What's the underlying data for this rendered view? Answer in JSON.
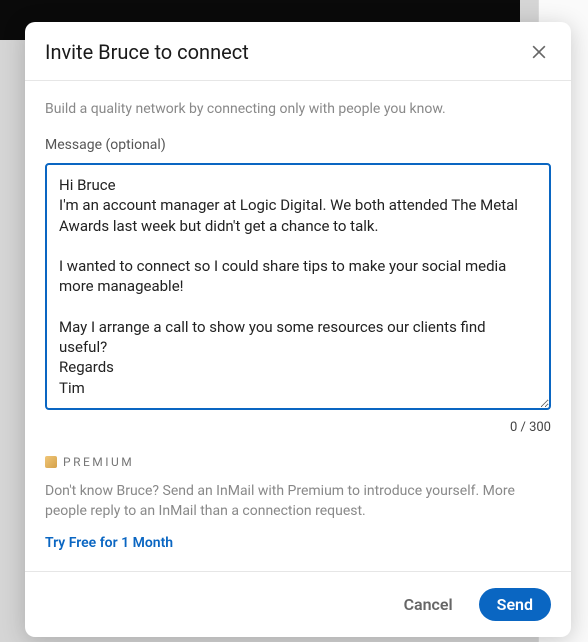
{
  "modal": {
    "title": "Invite Bruce to connect",
    "intro": "Build a quality network by connecting only with people you know.",
    "message_label": "Message (optional)",
    "message_value": "Hi Bruce\nI'm an account manager at Logic Digital. We both attended The Metal Awards last week but didn't get a chance to talk.\n\nI wanted to connect so I could share tips to make your social media more manageable!\n\nMay I arrange a call to show you some resources our clients find useful?\nRegards\nTim",
    "char_count": "0 / 300",
    "premium": {
      "label": "PREMIUM",
      "desc": "Don't know Bruce? Send an InMail with Premium to introduce yourself. More people reply to an InMail than a connection request.",
      "link": "Try Free for 1 Month"
    },
    "footer": {
      "cancel": "Cancel",
      "send": "Send"
    }
  }
}
